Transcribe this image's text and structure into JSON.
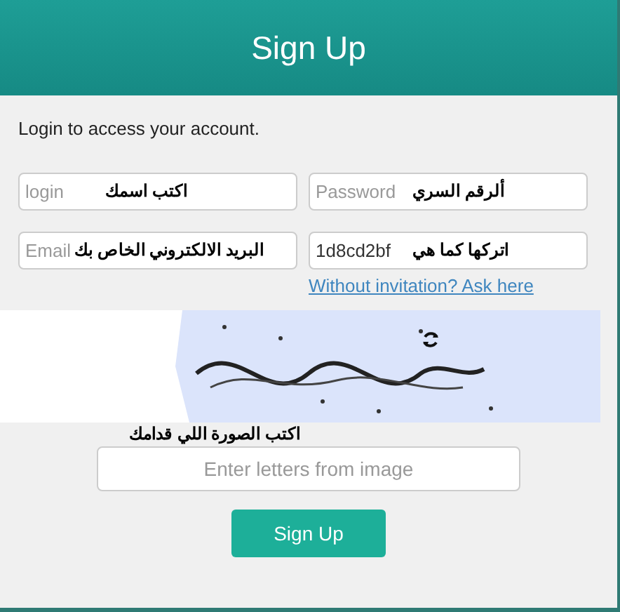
{
  "header": {
    "title": "Sign Up"
  },
  "intro": "Login to access your account.",
  "login_field": {
    "placeholder": "login",
    "annotation": "اكتب اسمك"
  },
  "password_field": {
    "placeholder": "Password",
    "annotation": "ألرقم السري"
  },
  "email_field": {
    "placeholder": "Email",
    "annotation": "البريد الالكتروني الخاص بك"
  },
  "code_field": {
    "value": "1d8cd2bf",
    "annotation": "اتركها كما هي"
  },
  "invitation_link": "Without invitation? Ask here",
  "captcha": {
    "kind": "picture",
    "annotation": "اكتب الصورة اللي قدامك"
  },
  "captcha_field": {
    "placeholder": "Enter letters from image"
  },
  "submit": "Sign Up"
}
